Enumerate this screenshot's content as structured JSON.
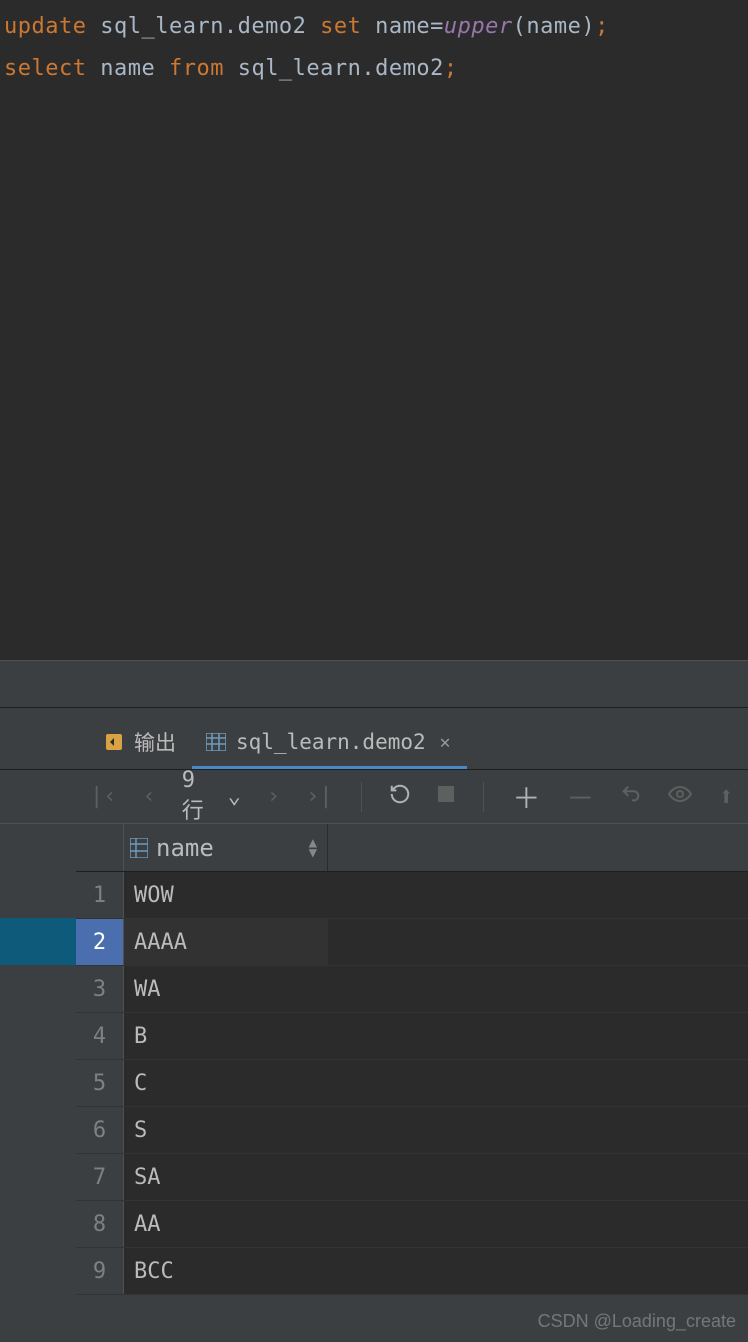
{
  "editor": {
    "line1": {
      "kw1": "update",
      "tbl": " sql_learn.demo2 ",
      "kw2": "set",
      "assign_l": " name=",
      "fn": "upper",
      "assign_r": "(name)",
      "semi": ";"
    },
    "line2": {
      "kw1": "select",
      "col": " name ",
      "kw2": "from",
      "tbl": " sql_learn.demo2",
      "semi": ";"
    }
  },
  "tabs": {
    "output": "输出",
    "data": "sql_learn.demo2"
  },
  "toolbar": {
    "rowcount": "9 行"
  },
  "grid": {
    "column": "name",
    "rows": [
      {
        "n": "1",
        "name": "WOW"
      },
      {
        "n": "2",
        "name": "AAAA"
      },
      {
        "n": "3",
        "name": "WA"
      },
      {
        "n": "4",
        "name": "B"
      },
      {
        "n": "5",
        "name": "C"
      },
      {
        "n": "6",
        "name": "S"
      },
      {
        "n": "7",
        "name": "SA"
      },
      {
        "n": "8",
        "name": "AA"
      },
      {
        "n": "9",
        "name": "BCC"
      }
    ]
  },
  "watermark": "CSDN @Loading_create"
}
